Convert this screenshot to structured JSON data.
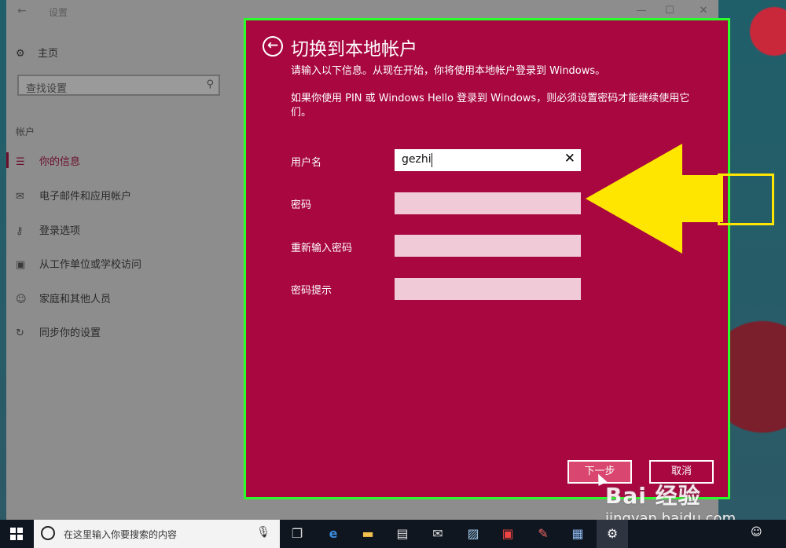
{
  "settings_window": {
    "title": "设置",
    "back_glyph": "←",
    "controls": {
      "minimize": "—",
      "maximize": "☐",
      "close": "✕"
    },
    "home_label": "主页",
    "search_placeholder": "查找设置",
    "section_label": "帐户",
    "nav_items": [
      {
        "label": "你的信息",
        "icon": "person-card-icon",
        "active": true
      },
      {
        "label": "电子邮件和应用帐户",
        "icon": "mail-icon",
        "active": false
      },
      {
        "label": "登录选项",
        "icon": "key-icon",
        "active": false
      },
      {
        "label": "从工作单位或学校访问",
        "icon": "briefcase-icon",
        "active": false
      },
      {
        "label": "家庭和其他人员",
        "icon": "people-icon",
        "active": false
      },
      {
        "label": "同步你的设置",
        "icon": "sync-icon",
        "active": false
      }
    ]
  },
  "dialog": {
    "title": "切换到本地帐户",
    "intro": "请输入以下信息。从现在开始，你将使用本地帐户登录到 Windows。",
    "note": "如果你使用 PIN 或 Windows Hello 登录到 Windows，则必须设置密码才能继续使用它们。",
    "fields": [
      {
        "label": "用户名",
        "value": "gezhi"
      },
      {
        "label": "密码",
        "value": ""
      },
      {
        "label": "重新输入密码",
        "value": ""
      },
      {
        "label": "密码提示",
        "value": ""
      }
    ],
    "buttons": {
      "next": "下一步",
      "cancel": "取消"
    },
    "accent_color": "#a8073f",
    "highlight_border_color": "#2bff2b"
  },
  "annotation": {
    "arrow_color": "#ffe600"
  },
  "watermark": {
    "brand": "Bai 经验",
    "url": "jingyan.baidu.com"
  },
  "taskbar": {
    "search_placeholder": "在这里输入你要搜索的内容",
    "icons": [
      "task-view-icon",
      "edge-icon",
      "file-explorer-icon",
      "store-icon",
      "mail-icon",
      "photos-icon",
      "app-icon",
      "paint-icon",
      "network-icon",
      "settings-icon"
    ]
  }
}
